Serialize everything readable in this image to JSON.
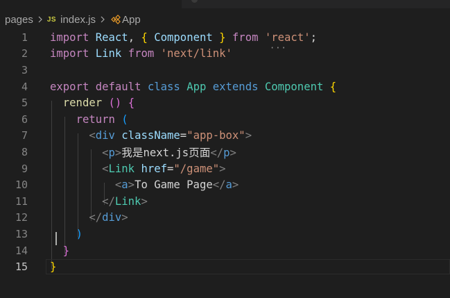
{
  "breadcrumb": {
    "folder": "pages",
    "file_badge": "JS",
    "file": "index.js",
    "symbol": "App"
  },
  "editor": {
    "language": "javascript",
    "current_line": 15,
    "lines": [
      {
        "n": "1",
        "tokens": [
          [
            "kw2",
            "import"
          ],
          [
            "txt",
            " "
          ],
          [
            "var",
            "React"
          ],
          [
            "txt",
            ", "
          ],
          [
            "br-y",
            "{"
          ],
          [
            "txt",
            " "
          ],
          [
            "var",
            "Component"
          ],
          [
            "txt",
            " "
          ],
          [
            "br-y",
            "}"
          ],
          [
            "txt",
            " "
          ],
          [
            "ctrl",
            "from"
          ],
          [
            "txt",
            " "
          ],
          [
            "str",
            "'react'"
          ],
          [
            "txt",
            ";"
          ]
        ]
      },
      {
        "n": "2",
        "tokens": [
          [
            "kw2",
            "import"
          ],
          [
            "txt",
            " "
          ],
          [
            "var",
            "Link"
          ],
          [
            "txt",
            " "
          ],
          [
            "ctrl",
            "from"
          ],
          [
            "txt",
            " "
          ],
          [
            "str",
            "'next/link'"
          ]
        ]
      },
      {
        "n": "3",
        "tokens": []
      },
      {
        "n": "4",
        "tokens": [
          [
            "kw2",
            "export"
          ],
          [
            "txt",
            " "
          ],
          [
            "kw2",
            "default"
          ],
          [
            "txt",
            " "
          ],
          [
            "kw",
            "class"
          ],
          [
            "txt",
            " "
          ],
          [
            "cls",
            "App"
          ],
          [
            "txt",
            " "
          ],
          [
            "kw",
            "extends"
          ],
          [
            "txt",
            " "
          ],
          [
            "cls",
            "Component"
          ],
          [
            "txt",
            " "
          ],
          [
            "br-y",
            "{"
          ]
        ]
      },
      {
        "n": "5",
        "tokens": [
          [
            "txt",
            "  "
          ],
          [
            "fn",
            "render"
          ],
          [
            "txt",
            " "
          ],
          [
            "br-p",
            "()"
          ],
          [
            "txt",
            " "
          ],
          [
            "br-p",
            "{"
          ]
        ]
      },
      {
        "n": "6",
        "tokens": [
          [
            "txt",
            "    "
          ],
          [
            "ctrl",
            "return"
          ],
          [
            "txt",
            " "
          ],
          [
            "br-b",
            "("
          ]
        ]
      },
      {
        "n": "7",
        "tokens": [
          [
            "txt",
            "      "
          ],
          [
            "punct",
            "<"
          ],
          [
            "tag",
            "div"
          ],
          [
            "txt",
            " "
          ],
          [
            "var",
            "className"
          ],
          [
            "txt",
            "="
          ],
          [
            "str",
            "\"app-box\""
          ],
          [
            "punct",
            ">"
          ]
        ]
      },
      {
        "n": "8",
        "tokens": [
          [
            "txt",
            "        "
          ],
          [
            "punct",
            "<"
          ],
          [
            "tag",
            "p"
          ],
          [
            "punct",
            ">"
          ],
          [
            "txt",
            "我是next.js页面"
          ],
          [
            "punct",
            "</"
          ],
          [
            "tag",
            "p"
          ],
          [
            "punct",
            ">"
          ]
        ]
      },
      {
        "n": "9",
        "tokens": [
          [
            "txt",
            "        "
          ],
          [
            "punct",
            "<"
          ],
          [
            "cls",
            "Link"
          ],
          [
            "txt",
            " "
          ],
          [
            "var",
            "href"
          ],
          [
            "txt",
            "="
          ],
          [
            "str",
            "\"/game\""
          ],
          [
            "punct",
            ">"
          ]
        ]
      },
      {
        "n": "10",
        "tokens": [
          [
            "txt",
            "          "
          ],
          [
            "punct",
            "<"
          ],
          [
            "tag",
            "a"
          ],
          [
            "punct",
            ">"
          ],
          [
            "txt",
            "To Game Page"
          ],
          [
            "punct",
            "</"
          ],
          [
            "tag",
            "a"
          ],
          [
            "punct",
            ">"
          ]
        ]
      },
      {
        "n": "11",
        "tokens": [
          [
            "txt",
            "        "
          ],
          [
            "punct",
            "</"
          ],
          [
            "cls",
            "Link"
          ],
          [
            "punct",
            ">"
          ]
        ]
      },
      {
        "n": "12",
        "tokens": [
          [
            "txt",
            "      "
          ],
          [
            "punct",
            "</"
          ],
          [
            "tag",
            "div"
          ],
          [
            "punct",
            ">"
          ]
        ]
      },
      {
        "n": "13",
        "tokens": [
          [
            "txt",
            "    "
          ],
          [
            "br-b",
            ")"
          ]
        ]
      },
      {
        "n": "14",
        "tokens": [
          [
            "txt",
            "  "
          ],
          [
            "br-p",
            "}"
          ]
        ]
      },
      {
        "n": "15",
        "tokens": [
          [
            "br-y",
            "}"
          ]
        ]
      }
    ]
  },
  "colors": {
    "background": "#1e1e1e",
    "keyword_control": "#c586c0",
    "keyword": "#569cd6",
    "variable": "#9cdcfe",
    "class": "#4ec9b0",
    "string": "#ce9178",
    "function": "#dcdcaa",
    "bracket_level1": "#ffd700",
    "bracket_level2": "#da70d6",
    "bracket_level3": "#179fff"
  }
}
